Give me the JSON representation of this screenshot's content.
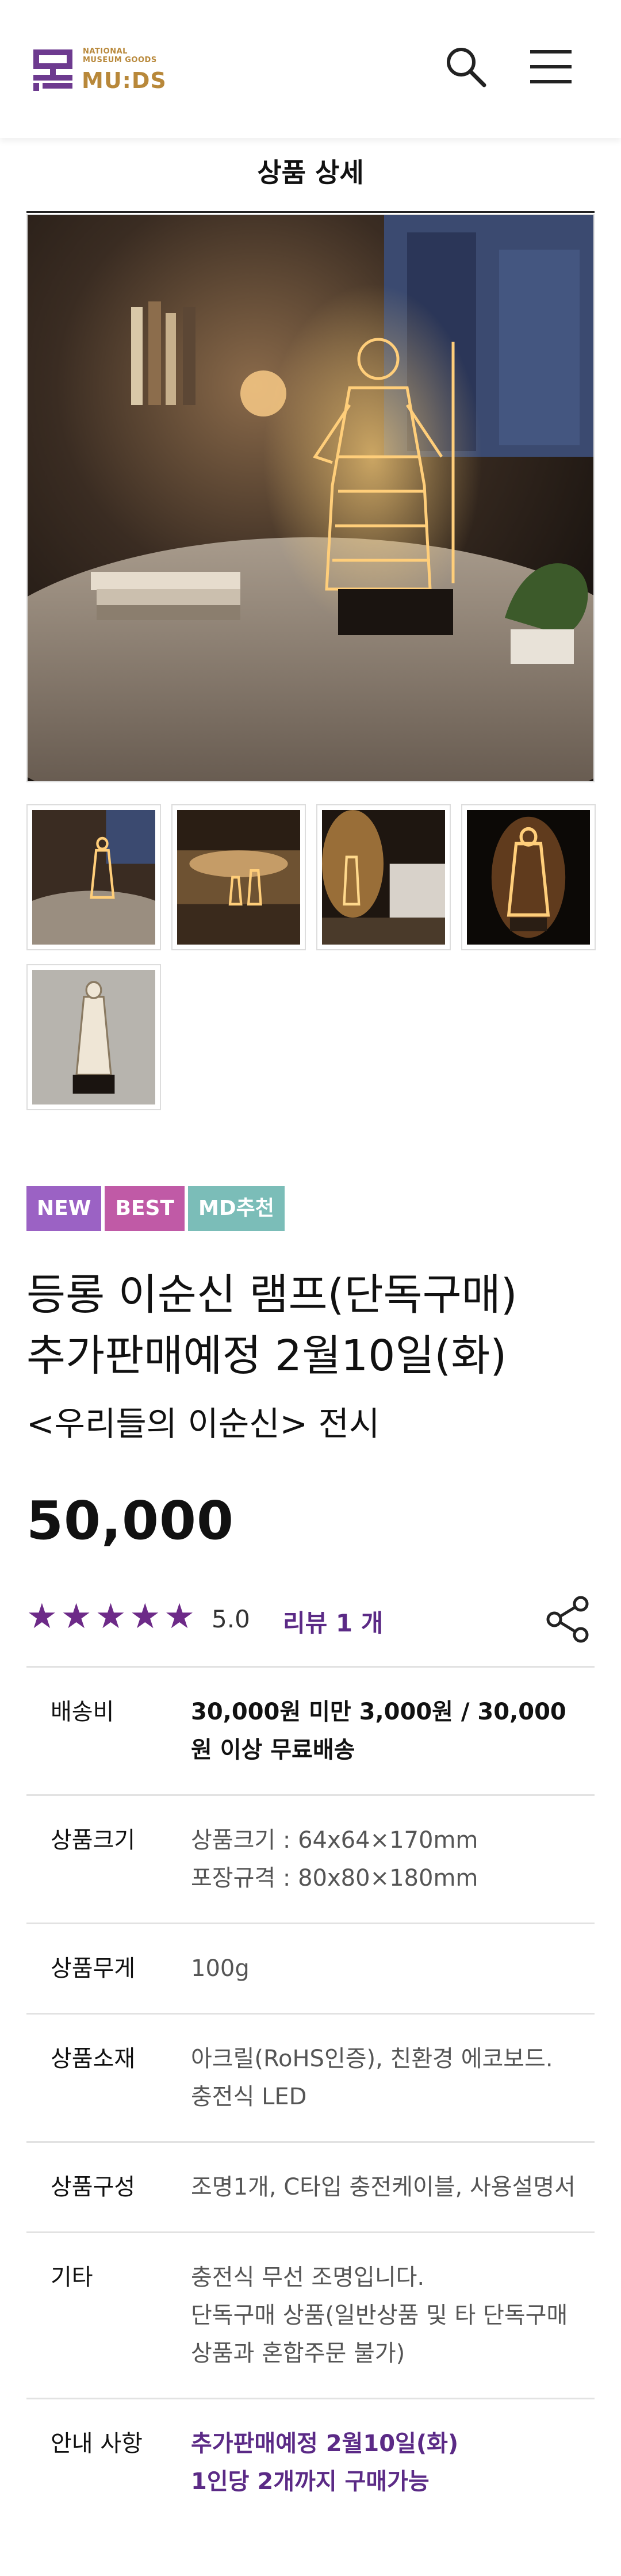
{
  "header": {
    "logo_small": "NATIONAL\nMUSEUM GOODS",
    "logo_big": "MU:DS",
    "search_icon": "search-icon",
    "menu_icon": "hamburger-menu-icon"
  },
  "section_title": "상품 상세",
  "badges": [
    {
      "label": "NEW",
      "color": "#9b62c4"
    },
    {
      "label": "BEST",
      "color": "#c05aa6"
    },
    {
      "label": "MD추천",
      "color": "#7bbdb8"
    }
  ],
  "product": {
    "title_line1": "등롱 이순신 램프(단독구매)",
    "title_line2": "추가판매예정 2월10일(화)",
    "subtitle": "<우리들의 이순신> 전시",
    "price": "50,000",
    "stars": "★★★★★",
    "rating": 5.0,
    "rating_text": "5.0",
    "review_text": "리뷰 1 개",
    "share_icon": "share-icon"
  },
  "info": [
    {
      "label": "배송비",
      "value": "30,000원 미만 3,000원 / 30,000원 이상 무료배송",
      "style": "bold"
    },
    {
      "label": "상품크기",
      "value": "상품크기 : 64x64×170mm\n포장규격 : 80x80×180mm",
      "style": "normal"
    },
    {
      "label": "상품무게",
      "value": "100g",
      "style": "normal"
    },
    {
      "label": "상품소재",
      "value": "아크릴(RoHS인증), 친환경 에코보드.\n충전식 LED",
      "style": "normal"
    },
    {
      "label": "상품구성",
      "value": "조명1개, C타입 충전케이블, 사용설명서",
      "style": "normal"
    },
    {
      "label": "기타",
      "value": "충전식 무선 조명입니다.\n단독구매 상품(일반상품 및 타 단독구매상품과 혼합주문 불가)",
      "style": "normal"
    },
    {
      "label": "안내 사항",
      "value": "추가판매예정 2월10일(화)\n1인당 2개까지 구매가능",
      "style": "purple"
    }
  ],
  "colors": {
    "brand_gold": "#b8883a",
    "brand_purple": "#5b2a86",
    "star_purple": "#6d2a88"
  }
}
